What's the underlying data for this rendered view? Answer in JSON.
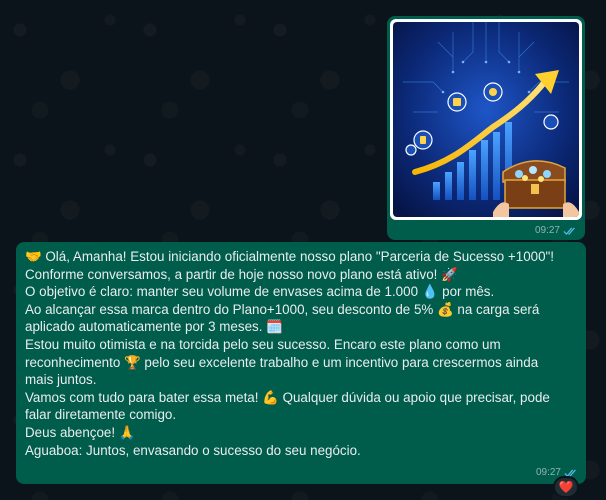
{
  "image_message": {
    "time": "09:27",
    "status_icon": "double-check-icon",
    "image_subject": "growth-arrow-treasure-chest"
  },
  "text_message": {
    "lines": [
      "🤝 Olá, Amanha! Estou iniciando oficialmente nosso plano \"Parceria de Sucesso +1000\"!",
      "Conforme conversamos, a partir de hoje nosso novo plano está ativo! 🚀",
      "O objetivo é claro: manter seu volume de envases acima de 1.000 💧 por mês.",
      "Ao alcançar essa marca dentro do Plano+1000, seu desconto de 5% 💰 na carga será",
      "aplicado automaticamente por 3 meses. 🗓️",
      "Estou muito otimista e na torcida pelo seu sucesso. Encaro este plano como um",
      "reconhecimento 🏆 pelo seu excelente trabalho e um incentivo para crescermos ainda",
      "mais juntos.",
      "Vamos com tudo para bater essa meta! 💪 Qualquer dúvida ou apoio que precisar, pode",
      "falar diretamente comigo.",
      "Deus abençoe! 🙏",
      "Aguaboa: Juntos, envasando o sucesso do seu negócio."
    ],
    "time": "09:27",
    "status_icon": "double-check-icon"
  },
  "reaction": {
    "emoji": "❤️"
  },
  "colors": {
    "background": "#0b141a",
    "outgoing_bubble": "#005c4b",
    "text": "#e9edef",
    "read_ticks": "#53bdeb"
  }
}
